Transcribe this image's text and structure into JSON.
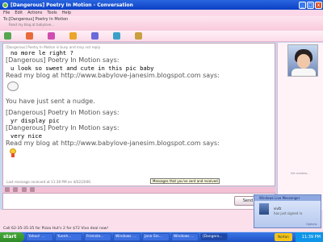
{
  "window": {
    "title": "[Dangerous] Poetry In Motion - Conversation",
    "controls": [
      "_",
      "□",
      "x"
    ]
  },
  "menu": [
    "File",
    "Edit",
    "Actions",
    "Tools",
    "Help"
  ],
  "header": {
    "to_label": "To:",
    "contact_name": "[Dangerous] Poetry In Motion",
    "contact_sub": "Read my blog at babylove..."
  },
  "conversation": {
    "lines": [
      {
        "type": "small",
        "text": "[Dangerous] Poetry In Motion is busy and may not reply."
      },
      {
        "type": "msg",
        "text": "no more le right ?"
      },
      {
        "type": "name",
        "text": "[Dangerous] Poetry In Motion says:"
      },
      {
        "type": "msg",
        "text": "u look so sweet and cute in this pic baby"
      },
      {
        "type": "name",
        "text": "Read my blog at http://www.babylove-janesim.blogspot.com says:"
      }
    ],
    "nudge_text": "You have just sent a nudge.",
    "lines2": [
      {
        "type": "name",
        "text": "[Dangerous] Poetry In Motion says:"
      },
      {
        "type": "msg",
        "text": "yr display pic"
      },
      {
        "type": "name",
        "text": "[Dangerous] Poetry In Motion says:"
      },
      {
        "type": "msg",
        "text": "very nice"
      },
      {
        "type": "name",
        "text": "Read my blog at http://www.babylove-janesim.blogspot.com says:"
      }
    ],
    "last_message": "Last message received at 11:39 PM on 4/02/2006.",
    "tooltip": "Messages that you've sent and received"
  },
  "compose": {
    "send_label": "Send"
  },
  "ad": {
    "text": "Call 62-35-35-35 for Pizza Hut's 2 for $72 Vivo deal now!",
    "link": "Options"
  },
  "popup": {
    "header": "Windows Live Messenger",
    "name": "vivfz",
    "status": "has just signed in.",
    "options": "Options"
  },
  "sidebar": {
    "label": "Set window..."
  },
  "taskbar": {
    "start": "start",
    "tasks": [
      "Yahoo! ...",
      "Yuenh...",
      "Frienste...",
      "Windows ...",
      "Jane Sin...",
      "Windows ...",
      "[Dangero..."
    ],
    "norton": "Norton",
    "clock": "11:39 PM"
  }
}
